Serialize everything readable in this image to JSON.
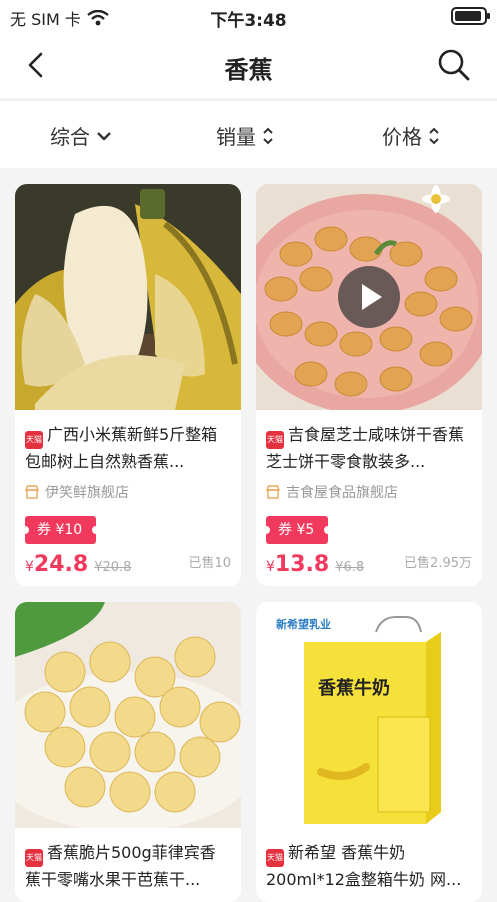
{
  "status_bar": {
    "carrier": "无 SIM 卡",
    "time": "下午3:48"
  },
  "nav": {
    "title": "香蕉"
  },
  "filters": [
    {
      "label": "综合",
      "icon": "chevron-down-icon"
    },
    {
      "label": "销量",
      "icon": "sort-icon"
    },
    {
      "label": "价格",
      "icon": "sort-icon"
    }
  ],
  "products": [
    {
      "badge": "天猫",
      "title": "广西小米蕉新鲜5斤整箱包邮树上自然熟香蕉...",
      "shop": "伊笑鲜旗舰店",
      "coupon": "券 ¥10",
      "price_symbol": "¥",
      "price": "24.8",
      "original_price": "¥20.8",
      "sold": "已售10"
    },
    {
      "badge": "天猫",
      "title": "吉食屋芝士咸味饼干香蕉芝士饼干零食散装多...",
      "shop": "吉食屋食品旗舰店",
      "coupon": "券 ¥5",
      "price_symbol": "¥",
      "price": "13.8",
      "original_price": "¥6.8",
      "sold": "已售2.95万"
    },
    {
      "badge": "天猫",
      "title": "香蕉脆片500g菲律宾香蕉干零嘴水果干芭蕉干..."
    },
    {
      "badge": "天猫",
      "title": "新希望 香蕉牛奶 200ml*12盒整箱牛奶 网...",
      "image_brand": "新希望乳业",
      "image_product": "香蕉牛奶"
    }
  ],
  "colors": {
    "accent": "#f1395d",
    "tmall": "#e4313f"
  }
}
